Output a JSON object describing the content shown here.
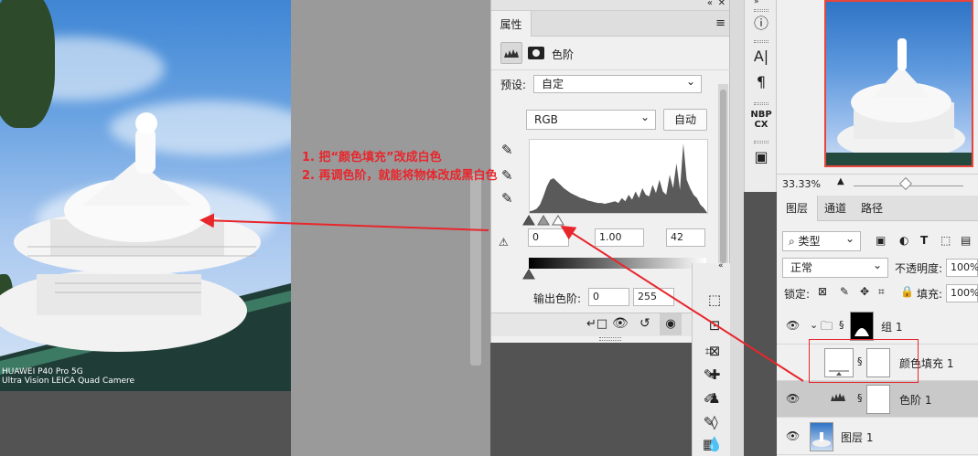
{
  "photo": {
    "watermark_line1": "HUAWEI P40 Pro 5G",
    "watermark_line2": "Ultra Vision LEICA Quad Camere"
  },
  "annotation": {
    "line1": "1. 把“颜色填充”改成白色",
    "line2": "2. 再调色阶，就能将物体改成黑白色",
    "color": "#e8262c"
  },
  "properties": {
    "tab_label": "属性",
    "panel_title": "色阶",
    "preset_label": "预设:",
    "preset_value": "自定",
    "channel_value": "RGB",
    "auto_label": "自动",
    "input_black": "0",
    "input_gamma": "1.00",
    "input_white": "42",
    "output_label": "输出色阶:",
    "output_black": "0",
    "output_white": "255"
  },
  "navigator": {
    "zoom": "33.33%"
  },
  "layers": {
    "tabs": [
      "图层",
      "通道",
      "路径"
    ],
    "filter_label": "类型",
    "blend_mode": "正常",
    "opacity_label": "不透明度:",
    "opacity_value": "100%",
    "lock_label": "锁定:",
    "fill_label": "填充:",
    "fill_value": "100%",
    "items": [
      {
        "name": "组 1"
      },
      {
        "name": "颜色填充 1"
      },
      {
        "name": "色阶 1"
      },
      {
        "name": "图层 1"
      }
    ]
  },
  "histogram_data": [
    2,
    3,
    5,
    10,
    20,
    32,
    40,
    42,
    38,
    34,
    30,
    27,
    24,
    22,
    20,
    18,
    17,
    15,
    14,
    13,
    12,
    12,
    11,
    12,
    13,
    14,
    12,
    18,
    14,
    22,
    16,
    26,
    18,
    30,
    22,
    20,
    34,
    24,
    40,
    26,
    22,
    46,
    30,
    60,
    28,
    84,
    40,
    30,
    22,
    18,
    10,
    6
  ]
}
